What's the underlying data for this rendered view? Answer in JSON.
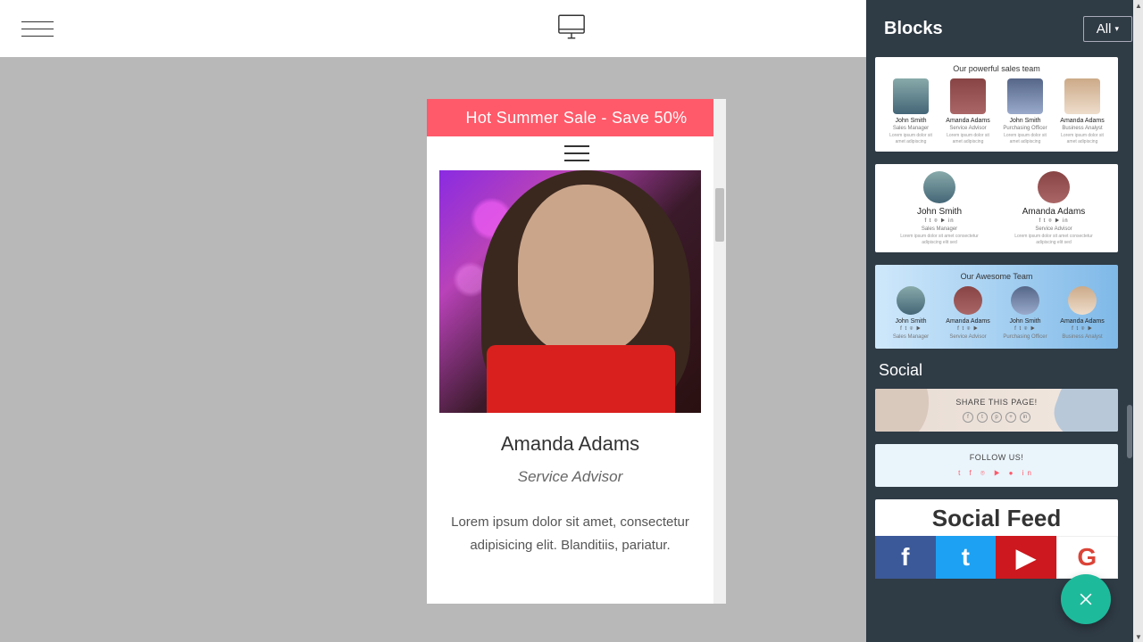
{
  "topbar": {},
  "preview": {
    "banner": "Hot Summer Sale - Save 50%",
    "card": {
      "name": "Amanda Adams",
      "role": "Service Advisor",
      "desc": "Lorem ipsum dolor sit amet, consectetur adipisicing elit. Blanditiis, pariatur."
    }
  },
  "sidebar": {
    "title": "Blocks",
    "filter": "All",
    "blocks": {
      "team4": {
        "title": "Our powerful sales team",
        "people": [
          {
            "name": "John Smith",
            "role": "Sales Manager"
          },
          {
            "name": "Amanda Adams",
            "role": "Service Advisor"
          },
          {
            "name": "John Smith",
            "role": "Purchasing Officer"
          },
          {
            "name": "Amanda Adams",
            "role": "Business Analyst"
          }
        ]
      },
      "team2": {
        "people": [
          {
            "name": "John Smith",
            "role": "Sales Manager"
          },
          {
            "name": "Amanda Adams",
            "role": "Service Advisor"
          }
        ]
      },
      "teamblue": {
        "title": "Our Awesome Team",
        "people": [
          {
            "name": "John Smith",
            "role": "Sales Manager"
          },
          {
            "name": "Amanda Adams",
            "role": "Service Advisor"
          },
          {
            "name": "John Smith",
            "role": "Purchasing Officer"
          },
          {
            "name": "Amanda Adams",
            "role": "Business Analyst"
          }
        ]
      }
    },
    "cat_social": "Social",
    "share": {
      "title": "SHARE THIS PAGE!"
    },
    "follow": {
      "title": "FOLLOW US!"
    },
    "feed": {
      "title": "Social Feed"
    }
  }
}
